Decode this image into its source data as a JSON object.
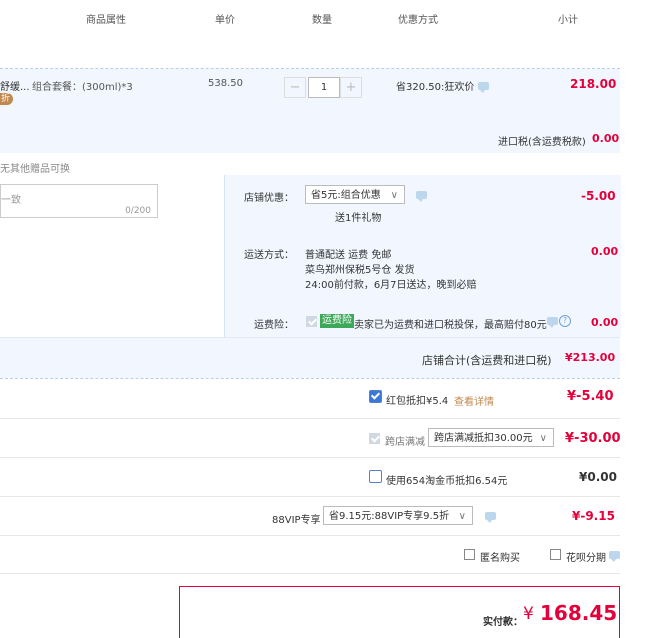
{
  "header": {
    "col_attr": "商品属性",
    "col_price": "单价",
    "col_qty": "数量",
    "col_promo": "优惠方式",
    "col_subtotal": "小计"
  },
  "item": {
    "name_fragment": "舒缓...",
    "variant": "组合套餐：(300ml)*3",
    "tag": "折",
    "unit_price": "538.50",
    "qty_minus": "−",
    "qty": "1",
    "qty_plus": "+",
    "promo": "省320.50:狂欢价",
    "subtotal": "218.00"
  },
  "tax": {
    "label": "进口税(含运费税款)",
    "value": "0.00"
  },
  "gift_note": "无其他赠品可换",
  "message": {
    "placeholder": "一致",
    "counter": "0/200"
  },
  "shop_discount": {
    "label": "店铺优惠：",
    "selected": "省5元:组合优惠",
    "gift": "送1件礼物",
    "value": "-5.00"
  },
  "shipping": {
    "label": "运送方式：",
    "line1": "普通配送 运费 免邮",
    "line2": "菜鸟郑州保税5号仓 发货",
    "line3": "24:00前付款，6月7日送达，晚到必赔",
    "value": "0.00"
  },
  "insurance": {
    "label": "运费险：",
    "badge": "运费险",
    "text": "卖家已为运费和进口税投保，最高赔付80元",
    "value": "0.00"
  },
  "shop_total": {
    "label": "店铺合计(含运费和进口税)",
    "value": "¥213.00"
  },
  "redpacket": {
    "label": "红包抵扣¥5.4",
    "link": "查看详情",
    "value": "¥-5.40"
  },
  "cross_store": {
    "label": "跨店满减",
    "selected": "跨店满减抵扣30.00元",
    "value": "¥-30.00"
  },
  "taobao_coin": {
    "label": "使用654淘金币抵扣6.54元",
    "value": "¥0.00"
  },
  "vip": {
    "label": "88VIP专享",
    "selected": "省9.15元:88VIP专享9.5折",
    "value": "¥-9.15"
  },
  "options": {
    "anonymous": "匿名购买",
    "huabei": "花呗分期"
  },
  "payment": {
    "label": "实付款：",
    "currency": "¥",
    "value": "168.45"
  },
  "colors": {
    "accent_red": "#e4003a",
    "section_bg": "#f2f7ff",
    "divider_blue": "#b6cfe6",
    "tag_bg": "#c0884f",
    "badge_green": "#3ea85a",
    "checkbox_blue": "#3a78d8"
  }
}
